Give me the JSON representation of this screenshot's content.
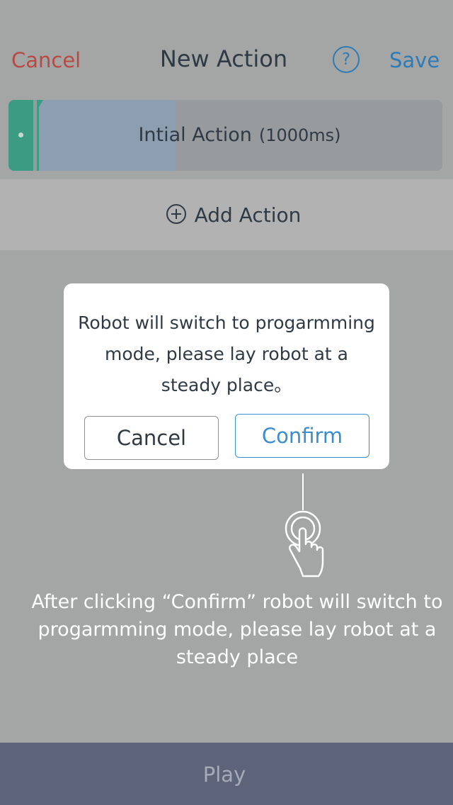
{
  "header": {
    "cancel_label": "Cancel",
    "title": "New Action",
    "help_symbol": "?",
    "save_label": "Save"
  },
  "action": {
    "name": "Intial Action",
    "duration": "(1000ms)"
  },
  "add_action": {
    "label": "Add Action",
    "icon": "plus-circle-icon"
  },
  "dialog": {
    "message": "Robot will switch to progarmming mode, please lay robot at a steady place。",
    "cancel_label": "Cancel",
    "confirm_label": "Confirm"
  },
  "hint": {
    "text": "After clicking  “Confirm” robot will switch to progarmming mode, please lay robot at a steady place",
    "icon": "tap-hand-icon"
  },
  "footer": {
    "play_label": "Play"
  },
  "colors": {
    "overlay_background": "#a4a6a5",
    "cancel_red": "#b74a45",
    "accent_blue": "#2f7bb6",
    "confirm_blue": "#3a8ed0",
    "action_green": "#3c9c83",
    "play_bar": "#5d6378"
  }
}
